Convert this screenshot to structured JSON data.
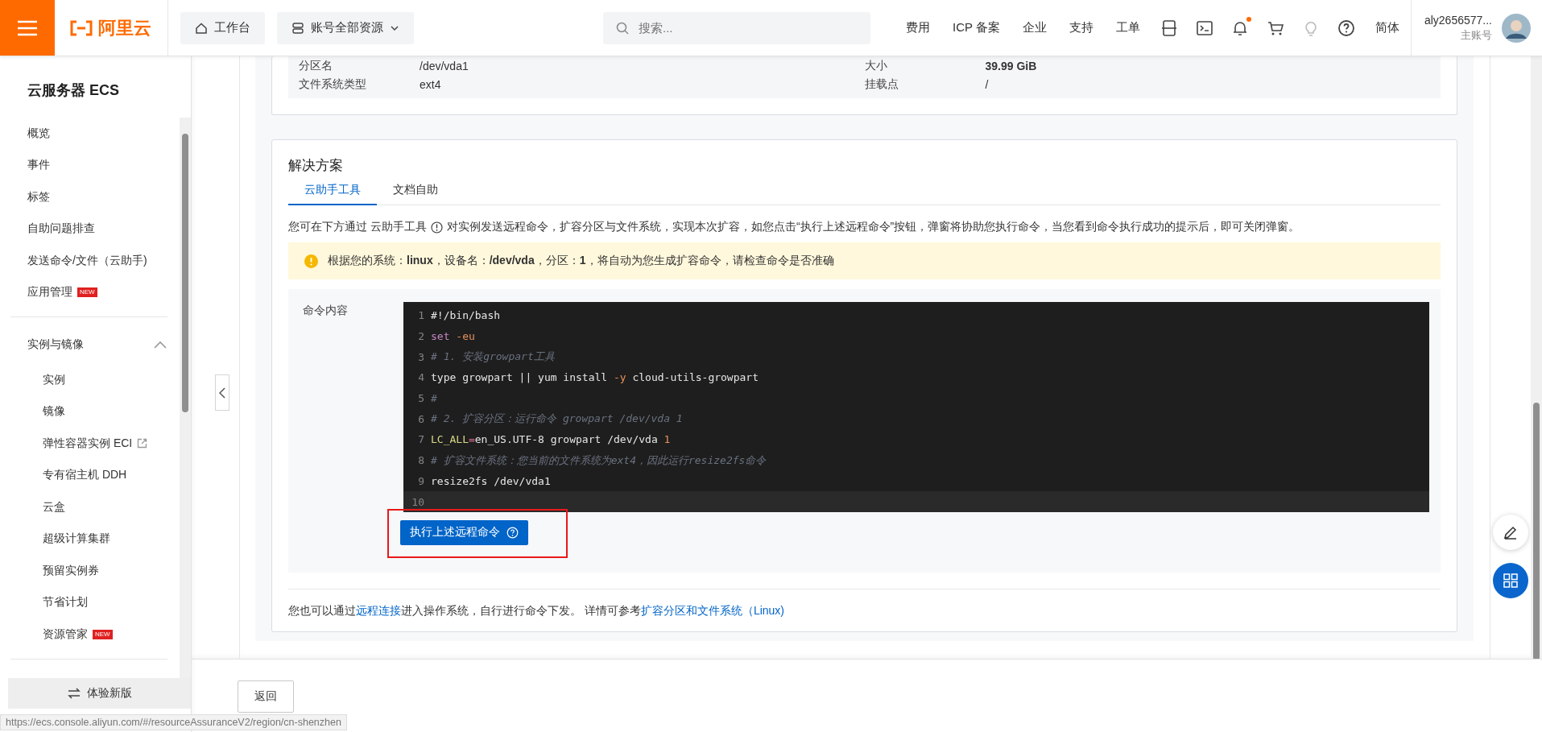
{
  "header": {
    "logo_text": "阿里云",
    "workbench": "工作台",
    "resources": "账号全部资源",
    "search": {
      "placeholder": "搜索..."
    },
    "nav": [
      "费用",
      "ICP 备案",
      "企业",
      "支持",
      "工单"
    ],
    "notification_dot": true,
    "language": "简体",
    "account": {
      "name": "aly2656577...",
      "role": "主账号"
    }
  },
  "sidebar": {
    "title": "云服务器 ECS",
    "items": [
      {
        "label": "概览"
      },
      {
        "label": "事件"
      },
      {
        "label": "标签"
      },
      {
        "label": "自助问题排查"
      },
      {
        "label": "发送命令/文件（云助手)"
      },
      {
        "label": "应用管理",
        "badge": "NEW"
      }
    ],
    "group": {
      "label": "实例与镜像",
      "expanded": true,
      "children": [
        {
          "label": "实例"
        },
        {
          "label": "镜像"
        },
        {
          "label": "弹性容器实例 ECI",
          "external": true
        },
        {
          "label": "专有宿主机 DDH"
        },
        {
          "label": "云盒"
        },
        {
          "label": "超级计算集群"
        },
        {
          "label": "预留实例券"
        },
        {
          "label": "节省计划"
        },
        {
          "label": "资源管家",
          "badge": "NEW"
        }
      ]
    },
    "footer_button": "体验新版"
  },
  "status_url": "https://ecs.console.aliyun.com/#/resourceAssuranceV2/region/cn-shenzhen",
  "info": [
    {
      "label": "分区名",
      "value": "/dev/vda1",
      "emphasis": false
    },
    {
      "label": "大小",
      "value": "39.99 GiB",
      "emphasis": true
    },
    {
      "label": "文件系统类型",
      "value": "ext4",
      "emphasis": false
    },
    {
      "label": "挂载点",
      "value": "/",
      "emphasis": false
    }
  ],
  "solution": {
    "title": "解决方案",
    "tabs": [
      {
        "label": "云助手工具",
        "selected": true
      },
      {
        "label": "文档自助",
        "selected": false
      }
    ],
    "intro_before": "您可在下方通过 云助手工具",
    "intro_after": "对实例发送远程命令，扩容分区与文件系统，实现本次扩容，如您点击“执行上述远程命令”按钮，弹窗将协助您执行命令，当您看到命令执行成功的提示后，即可关闭弹窗。",
    "alert": "根据您的系统：**linux**，设备名：**/dev/vda**，分区：**1**，将自动为您生成扩容命令，请检查命令是否准确",
    "command_label": "命令内容",
    "code": [
      {
        "number": "1",
        "current": false,
        "tokens": [
          {
            "text": "#!/bin/bash",
            "kind": "plain"
          }
        ]
      },
      {
        "number": "2",
        "current": false,
        "tokens": [
          {
            "text": "set",
            "kind": "keyword"
          },
          {
            "text": " -eu",
            "kind": "flag"
          }
        ]
      },
      {
        "number": "3",
        "current": false,
        "tokens": [
          {
            "text": "# 1. 安装growpart工具",
            "kind": "comment"
          }
        ]
      },
      {
        "number": "4",
        "current": false,
        "tokens": [
          {
            "text": "type growpart || yum install ",
            "kind": "plain"
          },
          {
            "text": "-y",
            "kind": "flag"
          },
          {
            "text": " cloud-utils-growpart",
            "kind": "plain"
          }
        ]
      },
      {
        "number": "5",
        "current": false,
        "tokens": [
          {
            "text": "#",
            "kind": "comment"
          }
        ]
      },
      {
        "number": "6",
        "current": false,
        "tokens": [
          {
            "text": "# 2. 扩容分区：运行命令 growpart /dev/vda 1",
            "kind": "comment"
          }
        ]
      },
      {
        "number": "7",
        "current": false,
        "tokens": [
          {
            "text": "LC_ALL",
            "kind": "variable"
          },
          {
            "text": "=",
            "kind": "operator"
          },
          {
            "text": "en_US.UTF-8 growpart /dev/vda ",
            "kind": "plain"
          },
          {
            "text": "1",
            "kind": "flag"
          }
        ]
      },
      {
        "number": "8",
        "current": false,
        "tokens": [
          {
            "text": "# 扩容文件系统：您当前的文件系统为ext4，因此运行resize2fs命令",
            "kind": "comment"
          }
        ]
      },
      {
        "number": "9",
        "current": false,
        "tokens": [
          {
            "text": "resize2fs /dev/vda1",
            "kind": "plain"
          }
        ]
      },
      {
        "number": "10",
        "current": true
      }
    ],
    "run_button": {
      "label": "执行上述远程命令",
      "highlighted": true
    },
    "footer": [
      {
        "text": "您也可以通过",
        "link": false
      },
      {
        "text": "远程连接",
        "link": true
      },
      {
        "text": "进入操作系统，自行进行命令下发。 详情可参考",
        "link": false
      },
      {
        "text": "扩容分区和文件系统（Linux)",
        "link": true
      }
    ]
  },
  "back_button": "返回"
}
